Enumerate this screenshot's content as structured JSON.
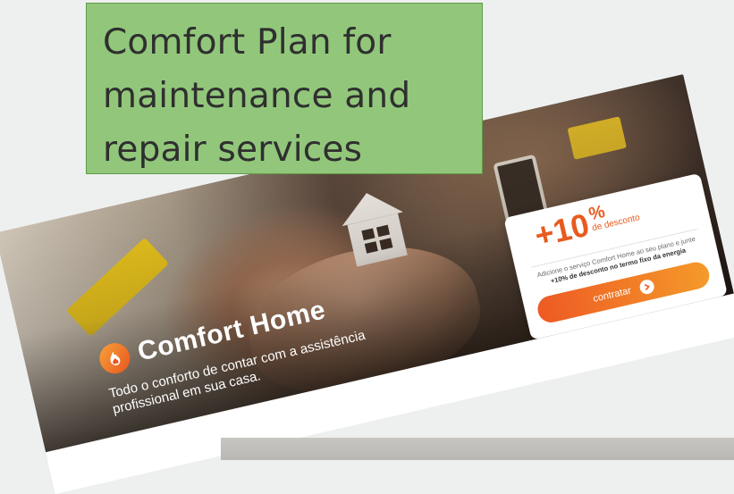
{
  "callout": {
    "text": "Comfort Plan for maintenance and repair services",
    "fill_color": "#92c77b"
  },
  "banner": {
    "brand_name": "Comfort Home",
    "tagline": "Todo o conforto de contar com a assistência profissional em sua casa.",
    "logo_icon": "flame-house-icon"
  },
  "offer": {
    "discount_value": "+10",
    "discount_percent": "%",
    "discount_label": "de desconto",
    "description_normal": "Adicione o serviço Comfort Home ao seu plano e junte",
    "description_bold": "+10% de desconto no termo fixo da energia",
    "cta_label": "contratar",
    "cta_icon": "arrow-right-icon",
    "accent_color": "#e85b1f"
  }
}
